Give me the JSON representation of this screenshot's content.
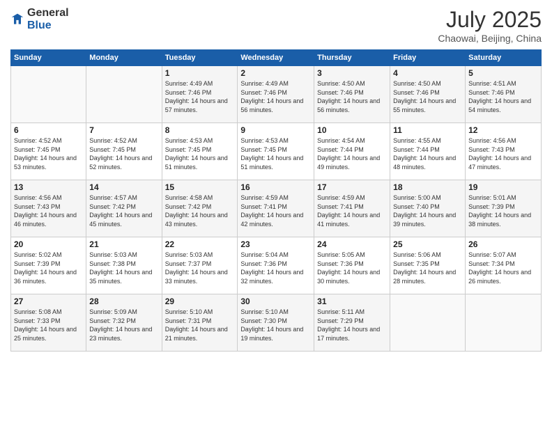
{
  "logo": {
    "general": "General",
    "blue": "Blue"
  },
  "header": {
    "month": "July 2025",
    "location": "Chaowai, Beijing, China"
  },
  "weekdays": [
    "Sunday",
    "Monday",
    "Tuesday",
    "Wednesday",
    "Thursday",
    "Friday",
    "Saturday"
  ],
  "weeks": [
    [
      {
        "day": "",
        "sunrise": "",
        "sunset": "",
        "daylight": ""
      },
      {
        "day": "",
        "sunrise": "",
        "sunset": "",
        "daylight": ""
      },
      {
        "day": "1",
        "sunrise": "Sunrise: 4:49 AM",
        "sunset": "Sunset: 7:46 PM",
        "daylight": "Daylight: 14 hours and 57 minutes."
      },
      {
        "day": "2",
        "sunrise": "Sunrise: 4:49 AM",
        "sunset": "Sunset: 7:46 PM",
        "daylight": "Daylight: 14 hours and 56 minutes."
      },
      {
        "day": "3",
        "sunrise": "Sunrise: 4:50 AM",
        "sunset": "Sunset: 7:46 PM",
        "daylight": "Daylight: 14 hours and 56 minutes."
      },
      {
        "day": "4",
        "sunrise": "Sunrise: 4:50 AM",
        "sunset": "Sunset: 7:46 PM",
        "daylight": "Daylight: 14 hours and 55 minutes."
      },
      {
        "day": "5",
        "sunrise": "Sunrise: 4:51 AM",
        "sunset": "Sunset: 7:46 PM",
        "daylight": "Daylight: 14 hours and 54 minutes."
      }
    ],
    [
      {
        "day": "6",
        "sunrise": "Sunrise: 4:52 AM",
        "sunset": "Sunset: 7:45 PM",
        "daylight": "Daylight: 14 hours and 53 minutes."
      },
      {
        "day": "7",
        "sunrise": "Sunrise: 4:52 AM",
        "sunset": "Sunset: 7:45 PM",
        "daylight": "Daylight: 14 hours and 52 minutes."
      },
      {
        "day": "8",
        "sunrise": "Sunrise: 4:53 AM",
        "sunset": "Sunset: 7:45 PM",
        "daylight": "Daylight: 14 hours and 51 minutes."
      },
      {
        "day": "9",
        "sunrise": "Sunrise: 4:53 AM",
        "sunset": "Sunset: 7:45 PM",
        "daylight": "Daylight: 14 hours and 51 minutes."
      },
      {
        "day": "10",
        "sunrise": "Sunrise: 4:54 AM",
        "sunset": "Sunset: 7:44 PM",
        "daylight": "Daylight: 14 hours and 49 minutes."
      },
      {
        "day": "11",
        "sunrise": "Sunrise: 4:55 AM",
        "sunset": "Sunset: 7:44 PM",
        "daylight": "Daylight: 14 hours and 48 minutes."
      },
      {
        "day": "12",
        "sunrise": "Sunrise: 4:56 AM",
        "sunset": "Sunset: 7:43 PM",
        "daylight": "Daylight: 14 hours and 47 minutes."
      }
    ],
    [
      {
        "day": "13",
        "sunrise": "Sunrise: 4:56 AM",
        "sunset": "Sunset: 7:43 PM",
        "daylight": "Daylight: 14 hours and 46 minutes."
      },
      {
        "day": "14",
        "sunrise": "Sunrise: 4:57 AM",
        "sunset": "Sunset: 7:42 PM",
        "daylight": "Daylight: 14 hours and 45 minutes."
      },
      {
        "day": "15",
        "sunrise": "Sunrise: 4:58 AM",
        "sunset": "Sunset: 7:42 PM",
        "daylight": "Daylight: 14 hours and 43 minutes."
      },
      {
        "day": "16",
        "sunrise": "Sunrise: 4:59 AM",
        "sunset": "Sunset: 7:41 PM",
        "daylight": "Daylight: 14 hours and 42 minutes."
      },
      {
        "day": "17",
        "sunrise": "Sunrise: 4:59 AM",
        "sunset": "Sunset: 7:41 PM",
        "daylight": "Daylight: 14 hours and 41 minutes."
      },
      {
        "day": "18",
        "sunrise": "Sunrise: 5:00 AM",
        "sunset": "Sunset: 7:40 PM",
        "daylight": "Daylight: 14 hours and 39 minutes."
      },
      {
        "day": "19",
        "sunrise": "Sunrise: 5:01 AM",
        "sunset": "Sunset: 7:39 PM",
        "daylight": "Daylight: 14 hours and 38 minutes."
      }
    ],
    [
      {
        "day": "20",
        "sunrise": "Sunrise: 5:02 AM",
        "sunset": "Sunset: 7:39 PM",
        "daylight": "Daylight: 14 hours and 36 minutes."
      },
      {
        "day": "21",
        "sunrise": "Sunrise: 5:03 AM",
        "sunset": "Sunset: 7:38 PM",
        "daylight": "Daylight: 14 hours and 35 minutes."
      },
      {
        "day": "22",
        "sunrise": "Sunrise: 5:03 AM",
        "sunset": "Sunset: 7:37 PM",
        "daylight": "Daylight: 14 hours and 33 minutes."
      },
      {
        "day": "23",
        "sunrise": "Sunrise: 5:04 AM",
        "sunset": "Sunset: 7:36 PM",
        "daylight": "Daylight: 14 hours and 32 minutes."
      },
      {
        "day": "24",
        "sunrise": "Sunrise: 5:05 AM",
        "sunset": "Sunset: 7:36 PM",
        "daylight": "Daylight: 14 hours and 30 minutes."
      },
      {
        "day": "25",
        "sunrise": "Sunrise: 5:06 AM",
        "sunset": "Sunset: 7:35 PM",
        "daylight": "Daylight: 14 hours and 28 minutes."
      },
      {
        "day": "26",
        "sunrise": "Sunrise: 5:07 AM",
        "sunset": "Sunset: 7:34 PM",
        "daylight": "Daylight: 14 hours and 26 minutes."
      }
    ],
    [
      {
        "day": "27",
        "sunrise": "Sunrise: 5:08 AM",
        "sunset": "Sunset: 7:33 PM",
        "daylight": "Daylight: 14 hours and 25 minutes."
      },
      {
        "day": "28",
        "sunrise": "Sunrise: 5:09 AM",
        "sunset": "Sunset: 7:32 PM",
        "daylight": "Daylight: 14 hours and 23 minutes."
      },
      {
        "day": "29",
        "sunrise": "Sunrise: 5:10 AM",
        "sunset": "Sunset: 7:31 PM",
        "daylight": "Daylight: 14 hours and 21 minutes."
      },
      {
        "day": "30",
        "sunrise": "Sunrise: 5:10 AM",
        "sunset": "Sunset: 7:30 PM",
        "daylight": "Daylight: 14 hours and 19 minutes."
      },
      {
        "day": "31",
        "sunrise": "Sunrise: 5:11 AM",
        "sunset": "Sunset: 7:29 PM",
        "daylight": "Daylight: 14 hours and 17 minutes."
      },
      {
        "day": "",
        "sunrise": "",
        "sunset": "",
        "daylight": ""
      },
      {
        "day": "",
        "sunrise": "",
        "sunset": "",
        "daylight": ""
      }
    ]
  ]
}
